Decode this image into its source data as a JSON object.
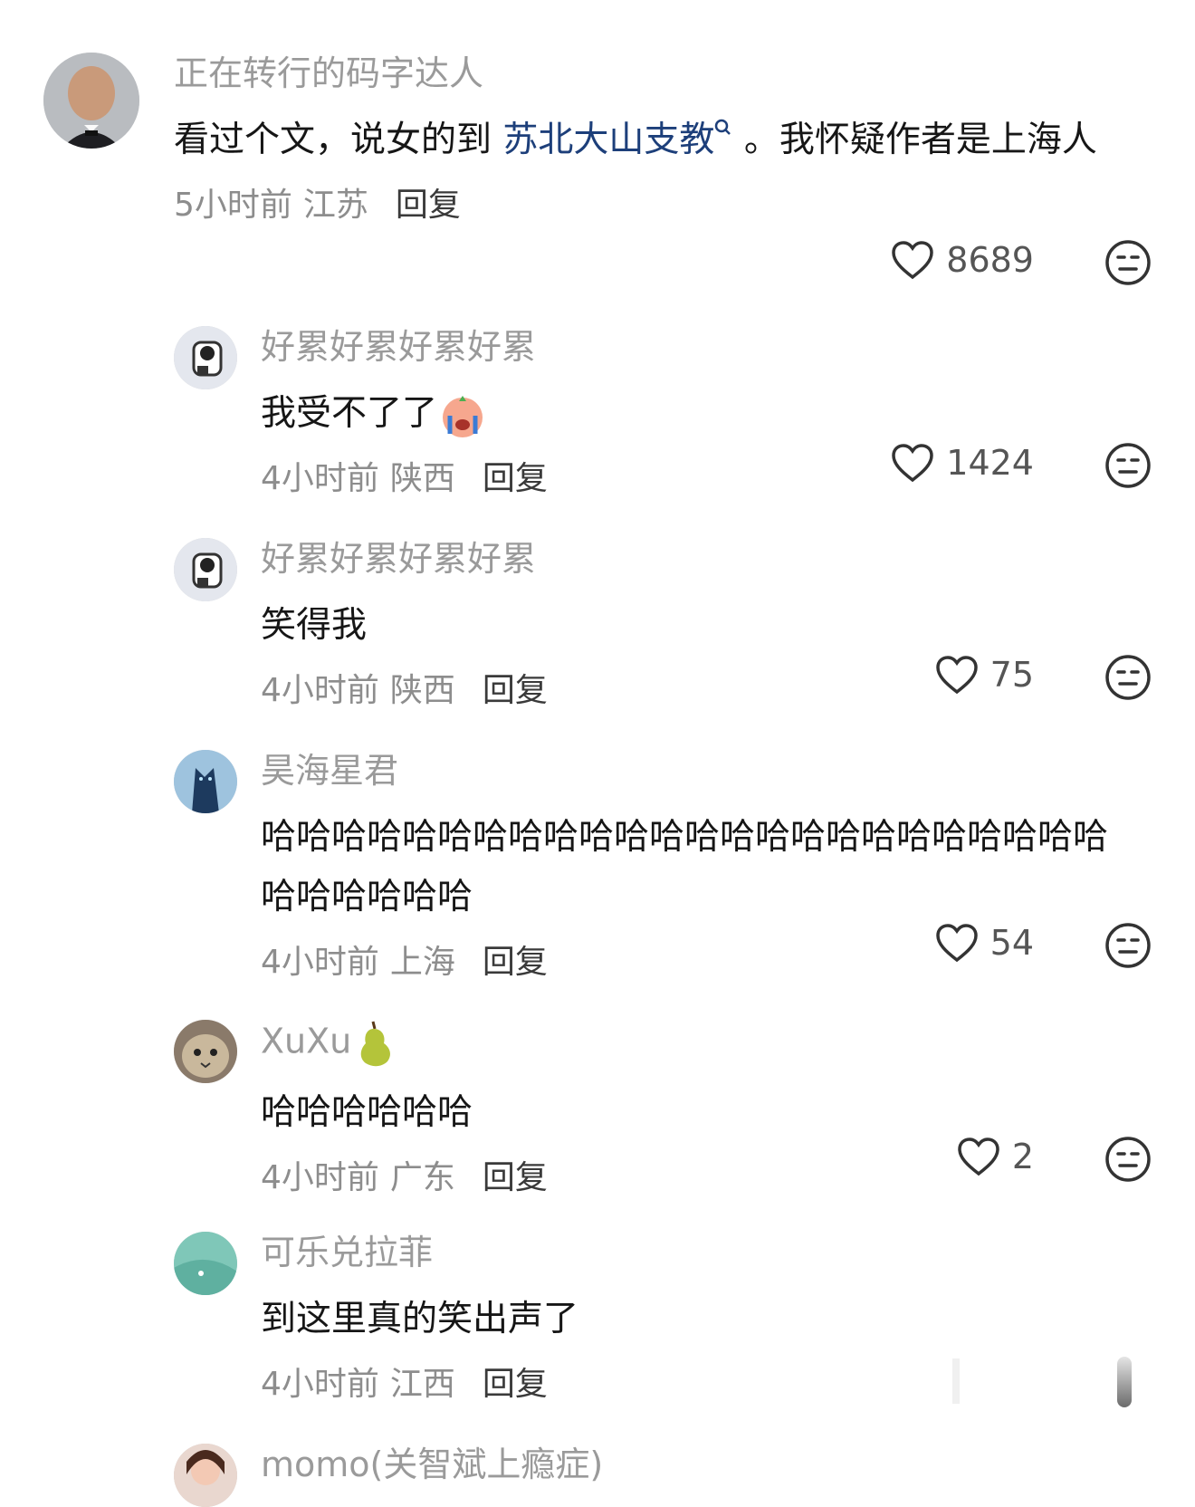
{
  "comments": [
    {
      "username": "正在转行的码字达人",
      "text_before": "看过个文，说女的到 ",
      "link_text": "苏北大山支教",
      "link_icon": "search-icon",
      "text_after": " 。我怀疑作者是上海人",
      "time": "5小时前",
      "region": "江苏",
      "reply": "回复",
      "likes": "8689"
    },
    {
      "username": "好累好累好累好累",
      "text": "我受不了了",
      "emoji": "crying-face-emoji",
      "time": "4小时前",
      "region": "陕西",
      "reply": "回复",
      "likes": "1424"
    },
    {
      "username": "好累好累好累好累",
      "text": "笑得我",
      "time": "4小时前",
      "region": "陕西",
      "reply": "回复",
      "likes": "75"
    },
    {
      "username": "昊海星君",
      "text": "哈哈哈哈哈哈哈哈哈哈哈哈哈哈哈哈哈哈哈哈哈哈哈哈哈哈哈哈哈哈",
      "time": "4小时前",
      "region": "上海",
      "reply": "回复",
      "likes": "54"
    },
    {
      "username": "XuXu",
      "username_emoji": "pear-emoji",
      "text": "哈哈哈哈哈哈",
      "time": "4小时前",
      "region": "广东",
      "reply": "回复",
      "likes": "2"
    },
    {
      "username": "可乐兑拉菲",
      "text": "到这里真的笑出声了",
      "time": "4小时前",
      "region": "江西",
      "reply": "回复"
    },
    {
      "username": "momo(关智斌上瘾症)"
    }
  ],
  "colors": {
    "username": "#9a9a9a",
    "link": "#1d3f7a",
    "meta": "#8d8d8d"
  }
}
